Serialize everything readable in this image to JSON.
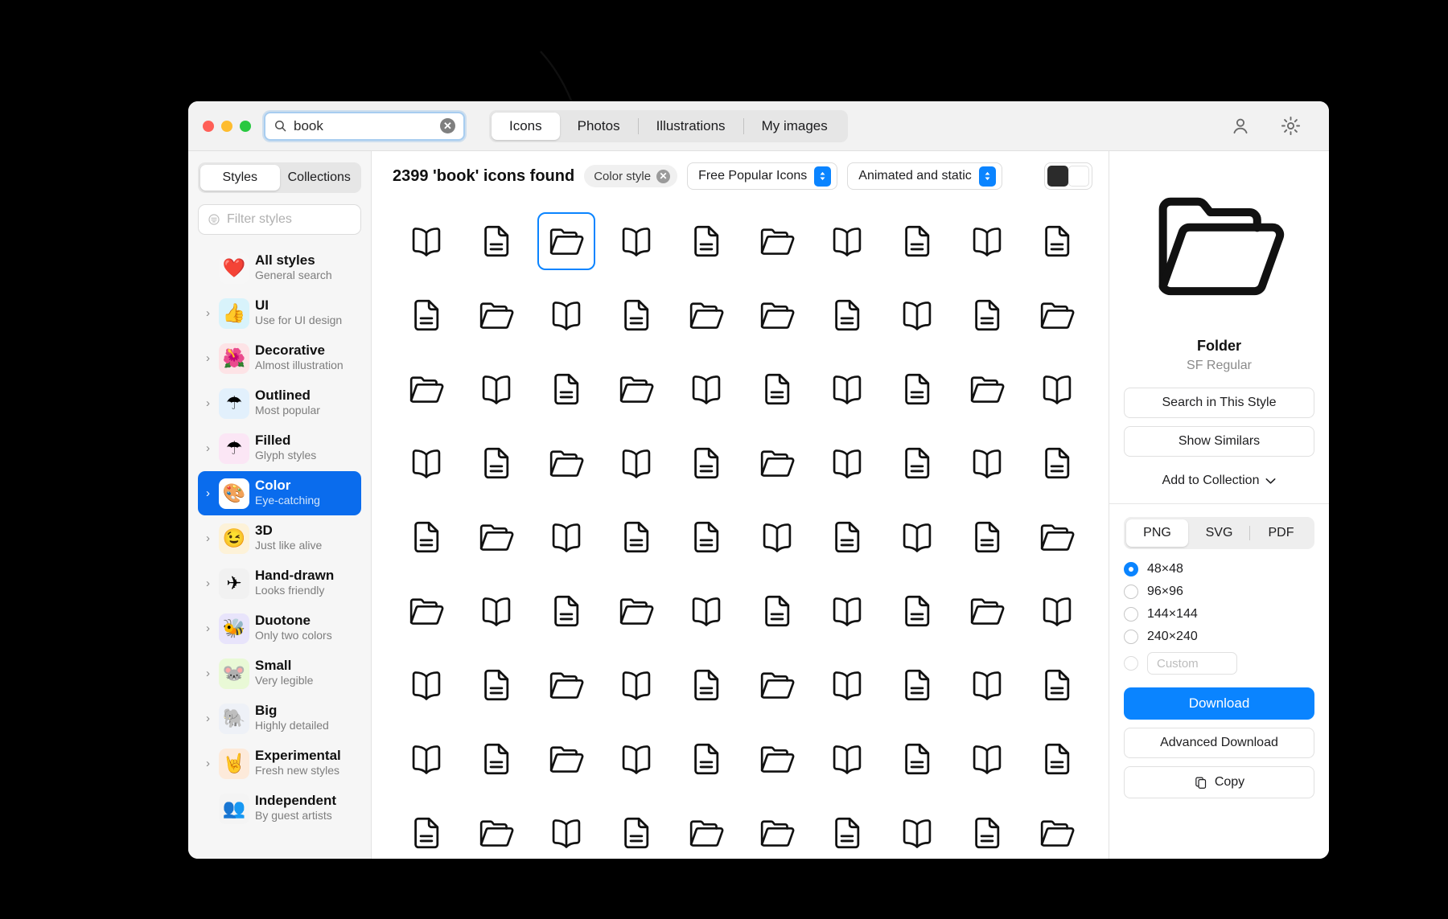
{
  "window": {
    "traffic_lights": [
      "close",
      "minimize",
      "zoom"
    ],
    "search": {
      "value": "book",
      "placeholder": "Search",
      "icon": "search-icon",
      "clear_icon": "clear-circle-icon"
    },
    "tabs": [
      {
        "label": "Icons",
        "active": true
      },
      {
        "label": "Photos",
        "active": false
      },
      {
        "label": "Illustrations",
        "active": false
      },
      {
        "label": "My images",
        "active": false
      }
    ],
    "header_actions": [
      {
        "name": "account-icon",
        "label": "Account"
      },
      {
        "name": "settings-gear-icon",
        "label": "Settings"
      }
    ]
  },
  "sidebar": {
    "segmented": [
      {
        "label": "Styles",
        "active": true
      },
      {
        "label": "Collections",
        "active": false
      }
    ],
    "filter": {
      "placeholder": "Filter styles",
      "icon": "filter-icon"
    },
    "items": [
      {
        "title": "All styles",
        "subtitle": "General search",
        "emoji": "❤️",
        "bg": "#f7f7f7",
        "expandable": false,
        "selected": false
      },
      {
        "title": "UI",
        "subtitle": "Use for UI design",
        "emoji": "👍",
        "bg": "#d8f3fb",
        "expandable": true,
        "selected": false
      },
      {
        "title": "Decorative",
        "subtitle": "Almost illustration",
        "emoji": "🌺",
        "bg": "#fde3e6",
        "expandable": true,
        "selected": false
      },
      {
        "title": "Outlined",
        "subtitle": "Most popular",
        "emoji": "☂",
        "bg": "#e2f0fc",
        "expandable": true,
        "selected": false
      },
      {
        "title": "Filled",
        "subtitle": "Glyph styles",
        "emoji": "☂",
        "bg": "#fbe6f5",
        "expandable": true,
        "selected": false
      },
      {
        "title": "Color",
        "subtitle": "Eye-catching",
        "emoji": "🎨",
        "bg": "#ffffff",
        "expandable": true,
        "selected": true
      },
      {
        "title": "3D",
        "subtitle": "Just like alive",
        "emoji": "😉",
        "bg": "#fdf2d8",
        "expandable": true,
        "selected": false
      },
      {
        "title": "Hand-drawn",
        "subtitle": "Looks friendly",
        "emoji": "✈",
        "bg": "#f1f1f1",
        "expandable": true,
        "selected": false
      },
      {
        "title": "Duotone",
        "subtitle": "Only two colors",
        "emoji": "🐝",
        "bg": "#e8e4fb",
        "expandable": true,
        "selected": false
      },
      {
        "title": "Small",
        "subtitle": "Very legible",
        "emoji": "🐭",
        "bg": "#e9f9d6",
        "expandable": true,
        "selected": false
      },
      {
        "title": "Big",
        "subtitle": "Highly detailed",
        "emoji": "🐘",
        "bg": "#eef1f7",
        "expandable": true,
        "selected": false
      },
      {
        "title": "Experimental",
        "subtitle": "Fresh new styles",
        "emoji": "🤘",
        "bg": "#fdeada",
        "expandable": true,
        "selected": false
      },
      {
        "title": "Independent",
        "subtitle": "By guest artists",
        "emoji": "👥",
        "bg": "#f4f4f4",
        "expandable": false,
        "selected": false
      }
    ]
  },
  "toolbar": {
    "result_count": "2399 'book' icons found",
    "active_chip": {
      "label": "Color style",
      "remove_icon": "close-circle-icon"
    },
    "pack_dropdown": {
      "value": "Free Popular Icons",
      "icon": "stepper-updown-icon"
    },
    "animation_dropdown": {
      "value": "Animated and static",
      "icon": "stepper-updown-icon"
    },
    "color_toggle": {
      "dark_swatch": "#2b2b2b",
      "light_swatch": "#ffffff"
    }
  },
  "grid": {
    "selected_index": 2,
    "icon_types": [
      "book",
      "document",
      "folder",
      "book",
      "document",
      "folder",
      "book",
      "document",
      "book",
      "document",
      "document",
      "folder",
      "book",
      "document",
      "folder",
      "folder",
      "document",
      "book",
      "document",
      "folder",
      "folder",
      "book",
      "document",
      "folder",
      "book",
      "document",
      "book",
      "document",
      "folder",
      "book",
      "book",
      "document",
      "folder",
      "book",
      "document",
      "folder",
      "book",
      "document",
      "book",
      "document",
      "document",
      "folder",
      "book",
      "document",
      "document",
      "book",
      "document",
      "book",
      "document",
      "folder",
      "folder",
      "book",
      "document",
      "folder",
      "book",
      "document",
      "book",
      "document",
      "folder",
      "book",
      "book",
      "document",
      "folder",
      "book",
      "document",
      "folder",
      "book",
      "document",
      "book",
      "document",
      "book",
      "document",
      "folder",
      "book",
      "document",
      "folder",
      "book",
      "document",
      "book",
      "document",
      "document",
      "folder",
      "book",
      "document",
      "folder",
      "folder",
      "document",
      "book",
      "document",
      "folder"
    ]
  },
  "detail": {
    "icon_name": "Folder",
    "icon_style": "SF Regular",
    "preview_icon": "folder-open-icon",
    "actions": [
      {
        "label": "Search in This Style",
        "name": "search-in-this-style-button"
      },
      {
        "label": "Show Similars",
        "name": "show-similars-button"
      }
    ],
    "add_to_collection": {
      "label": "Add to Collection",
      "icon": "chevron-down-icon"
    },
    "formats": [
      {
        "label": "PNG",
        "active": true
      },
      {
        "label": "SVG",
        "active": false
      },
      {
        "label": "PDF",
        "active": false
      }
    ],
    "sizes": [
      {
        "label": "48×48",
        "selected": true,
        "disabled": false
      },
      {
        "label": "96×96",
        "selected": false,
        "disabled": false
      },
      {
        "label": "144×144",
        "selected": false,
        "disabled": false
      },
      {
        "label": "240×240",
        "selected": false,
        "disabled": false
      }
    ],
    "custom_size": {
      "placeholder": "Custom",
      "selected": false,
      "disabled": true
    },
    "download_button": {
      "label": "Download",
      "color": "#0a84ff"
    },
    "advanced_download_button": {
      "label": "Advanced Download"
    },
    "copy_button": {
      "label": "Copy",
      "icon": "copy-icon"
    }
  },
  "annotation": {
    "caption": "",
    "arrow": "curved-arrow-pointing-to-results"
  }
}
